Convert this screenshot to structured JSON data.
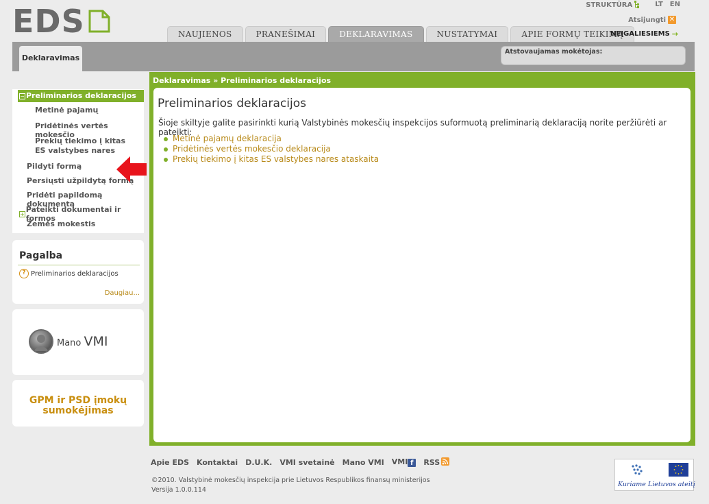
{
  "header": {
    "logo_text": "EDS",
    "top_links": {
      "structure": "STRUKTŪRA",
      "lang_lt": "LT",
      "lang_en": "EN"
    },
    "logout": "Atsijungti",
    "tabs": [
      {
        "label": "NAUJIENOS"
      },
      {
        "label": "PRANEŠIMAI"
      },
      {
        "label": "DEKLARAVIMAS"
      },
      {
        "label": "NUSTATYMAI"
      },
      {
        "label": "APIE FORMŲ TEIKIMĄ"
      }
    ],
    "disabled_link": "NEĮGALIESIEMS",
    "subtab": "Deklaravimas",
    "payer_label": "Atstovaujamas mokėtojas:"
  },
  "sidebar": {
    "items": [
      {
        "label": "Preliminarios deklaracijos"
      },
      {
        "label": "Metinė pajamų"
      },
      {
        "label": "Pridėtinės vertės mokesčio"
      },
      {
        "label": "Prekių tiekimo į kitas ES valstybes nares"
      },
      {
        "label": "Pildyti formą"
      },
      {
        "label": "Persiųsti užpildytą formą"
      },
      {
        "label": "Pridėti papildomą dokumentą"
      },
      {
        "label": "Pateikti dokumentai ir formos"
      },
      {
        "label": "Žemės mokestis"
      }
    ],
    "toggles": {
      "expanded": "−",
      "collapsed": "+"
    }
  },
  "help": {
    "title": "Pagalba",
    "item": "Preliminarios deklaracijos",
    "more": "Daugiau...",
    "q_symbol": "?"
  },
  "manovmi": {
    "prefix": "Mano",
    "brand": "VMI"
  },
  "gpm": {
    "line1": "GPM ir PSD įmokų",
    "line2": "sumokėjimas"
  },
  "main": {
    "breadcrumb": "Deklaravimas » Preliminarios deklaracijos",
    "title": "Preliminarios deklaracijos",
    "intro": "Šioje skiltyje galite pasirinkti kurią Valstybinės mokesčių inspekcijos suformuotą preliminarią deklaraciją norite peržiūrėti ar pateikti:",
    "links": [
      {
        "label": "Metinė pajamų deklaracija"
      },
      {
        "label": "Pridėtinės vertės mokesčio deklaracija"
      },
      {
        "label": "Prekių tiekimo į kitas ES valstybes nares ataskaita"
      }
    ]
  },
  "footer": {
    "links": [
      {
        "label": "Apie EDS"
      },
      {
        "label": "Kontaktai"
      },
      {
        "label": "D.U.K."
      },
      {
        "label": "VMI svetainė"
      },
      {
        "label": "Mano VMI"
      },
      {
        "label": "VMI"
      },
      {
        "label": "RSS"
      }
    ],
    "fb_letter": "f",
    "copyright": "©2010. Valstybinė mokesčių inspekcija prie Lietuvos Respublikos finansų ministerijos",
    "version": "Versija 1.0.0.114",
    "eu_slogan": "Kuriame Lietuvos ateitį"
  },
  "colors": {
    "accent_green": "#80b02a",
    "link_gold": "#b88a1a",
    "alert_red": "#e8141c",
    "logout_orange": "#f29a2e"
  }
}
